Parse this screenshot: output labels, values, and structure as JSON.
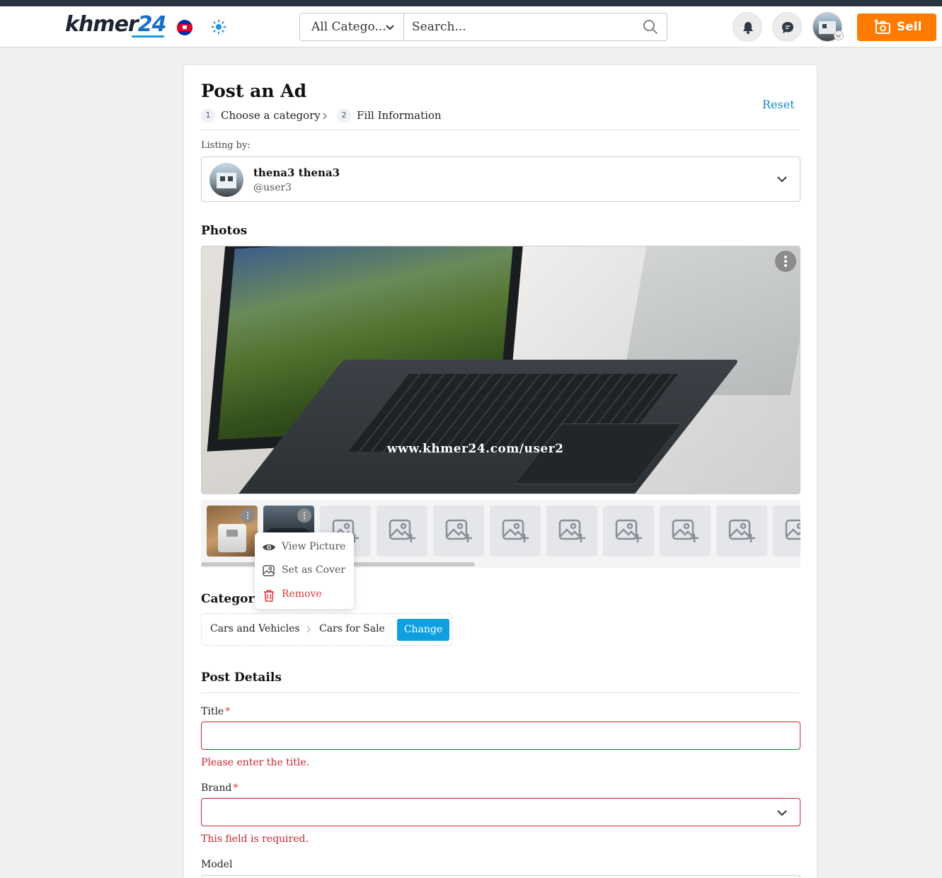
{
  "header": {
    "logo_text": "khmer",
    "logo_num": "24",
    "category_select": "All Catego...",
    "search_placeholder": "Search...",
    "sell_label": "Sell"
  },
  "page": {
    "title": "Post an Ad",
    "steps": [
      {
        "num": "1",
        "label": "Choose a category"
      },
      {
        "num": "2",
        "label": "Fill Information"
      }
    ],
    "reset_label": "Reset",
    "listing_by_label": "Listing by:",
    "listing_user": {
      "name": "thena3 thena3",
      "handle": "@user3"
    }
  },
  "photos": {
    "heading": "Photos",
    "watermark": "www.khmer24.com/user2",
    "empty_slots": 9,
    "context_menu": [
      {
        "label": "View Picture",
        "icon": "eye-icon"
      },
      {
        "label": "Set as Cover",
        "icon": "image-icon"
      },
      {
        "label": "Remove",
        "icon": "trash-icon"
      }
    ]
  },
  "category": {
    "heading": "Category",
    "path": [
      "Cars and Vehicles",
      "Cars for Sale"
    ],
    "change_label": "Change"
  },
  "post_details": {
    "heading": "Post Details",
    "title_label": "Title",
    "title_value": "",
    "title_error": "Please enter the title.",
    "brand_label": "Brand",
    "brand_value": "",
    "brand_error": "This field is required.",
    "model_label": "Model",
    "required_mark": "*"
  },
  "colors": {
    "accent": "#ff7a00",
    "link": "#1a8ac7",
    "primary_button": "#0e9fe0",
    "error": "#c4262e"
  }
}
